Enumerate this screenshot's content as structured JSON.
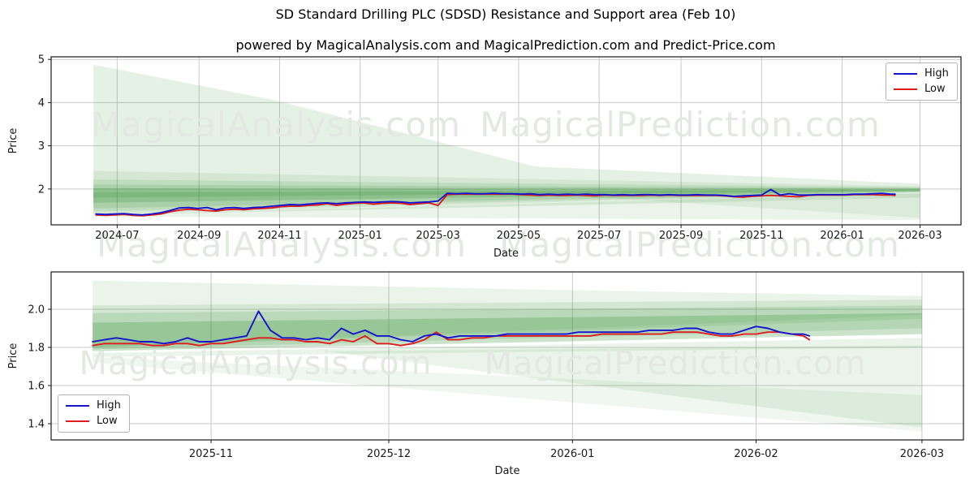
{
  "title": "SD Standard Drilling PLC (SDSD) Resistance and Support area (Feb 10)",
  "subtitle": "powered by MagicalAnalysis.com and MagicalPrediction.com and Predict-Price.com",
  "watermarks": [
    "MagicalAnalysis.com",
    "MagicalPrediction.com"
  ],
  "legend": {
    "high_label": "High",
    "low_label": "Low"
  },
  "colors": {
    "high": "#1414cc",
    "low": "#dc1e1e",
    "band": "#2f8f2f",
    "grid": "#c9c9c9",
    "spine": "#1a1a1a",
    "tick_text": "#1a1a1a",
    "watermark": "#e3e8e3"
  },
  "chart_data": [
    {
      "type": "line",
      "title": "SD Standard Drilling PLC (SDSD) Resistance and Support area (Feb 10)",
      "xlabel": "Date",
      "ylabel": "Price",
      "legend_position": "top-right",
      "grid": true,
      "x_domain": [
        "2024-05-12",
        "2026-04-01"
      ],
      "y_domain": [
        1.17,
        5.06
      ],
      "x_ticks": [
        {
          "date": "2024-07-01",
          "label": "2024-07"
        },
        {
          "date": "2024-09-01",
          "label": "2024-09"
        },
        {
          "date": "2024-11-01",
          "label": "2024-11"
        },
        {
          "date": "2025-01-01",
          "label": "2025-01"
        },
        {
          "date": "2025-03-01",
          "label": "2025-03"
        },
        {
          "date": "2025-05-01",
          "label": "2025-05"
        },
        {
          "date": "2025-07-01",
          "label": "2025-07"
        },
        {
          "date": "2025-09-01",
          "label": "2025-09"
        },
        {
          "date": "2025-11-01",
          "label": "2025-11"
        },
        {
          "date": "2026-01-01",
          "label": "2026-01"
        },
        {
          "date": "2026-03-01",
          "label": "2026-03"
        }
      ],
      "y_ticks": [
        {
          "value": 2,
          "label": "2"
        },
        {
          "value": 3,
          "label": "3"
        },
        {
          "value": 4,
          "label": "4"
        },
        {
          "value": 5,
          "label": "5"
        }
      ],
      "dates": [
        "2024-06-15",
        "2024-06-22",
        "2024-06-29",
        "2024-07-06",
        "2024-07-13",
        "2024-07-20",
        "2024-07-27",
        "2024-08-03",
        "2024-08-10",
        "2024-08-17",
        "2024-08-24",
        "2024-08-31",
        "2024-09-07",
        "2024-09-14",
        "2024-09-21",
        "2024-09-28",
        "2024-10-05",
        "2024-10-12",
        "2024-10-19",
        "2024-10-26",
        "2024-11-02",
        "2024-11-09",
        "2024-11-16",
        "2024-11-23",
        "2024-11-30",
        "2024-12-07",
        "2024-12-14",
        "2024-12-21",
        "2024-12-28",
        "2025-01-04",
        "2025-01-11",
        "2025-01-18",
        "2025-01-25",
        "2025-02-01",
        "2025-02-08",
        "2025-02-15",
        "2025-02-22",
        "2025-03-01",
        "2025-03-08",
        "2025-03-15",
        "2025-03-22",
        "2025-03-29",
        "2025-04-05",
        "2025-04-12",
        "2025-04-19",
        "2025-04-26",
        "2025-05-03",
        "2025-05-10",
        "2025-05-17",
        "2025-05-24",
        "2025-05-31",
        "2025-06-07",
        "2025-06-14",
        "2025-06-21",
        "2025-06-28",
        "2025-07-05",
        "2025-07-12",
        "2025-07-19",
        "2025-07-26",
        "2025-08-02",
        "2025-08-09",
        "2025-08-16",
        "2025-08-23",
        "2025-08-30",
        "2025-09-06",
        "2025-09-13",
        "2025-09-20",
        "2025-09-27",
        "2025-10-04",
        "2025-10-11",
        "2025-10-18",
        "2025-10-25",
        "2025-11-01",
        "2025-11-08",
        "2025-11-15",
        "2025-11-22",
        "2025-11-29",
        "2025-12-06",
        "2025-12-13",
        "2025-12-20",
        "2025-12-27",
        "2026-01-03",
        "2026-01-10",
        "2026-01-17",
        "2026-01-24",
        "2026-01-31",
        "2026-02-07",
        "2026-02-10"
      ],
      "series": [
        {
          "name": "High",
          "values": [
            1.42,
            1.41,
            1.42,
            1.43,
            1.41,
            1.4,
            1.42,
            1.45,
            1.5,
            1.56,
            1.57,
            1.55,
            1.57,
            1.52,
            1.56,
            1.57,
            1.55,
            1.57,
            1.58,
            1.6,
            1.62,
            1.64,
            1.63,
            1.65,
            1.67,
            1.68,
            1.66,
            1.68,
            1.69,
            1.7,
            1.69,
            1.7,
            1.71,
            1.7,
            1.68,
            1.69,
            1.7,
            1.72,
            1.9,
            1.89,
            1.9,
            1.89,
            1.89,
            1.9,
            1.89,
            1.89,
            1.88,
            1.89,
            1.87,
            1.88,
            1.87,
            1.88,
            1.87,
            1.88,
            1.87,
            1.87,
            1.86,
            1.87,
            1.86,
            1.87,
            1.87,
            1.86,
            1.87,
            1.86,
            1.86,
            1.87,
            1.86,
            1.86,
            1.85,
            1.83,
            1.84,
            1.85,
            1.86,
            1.99,
            1.86,
            1.89,
            1.86,
            1.86,
            1.87,
            1.87,
            1.87,
            1.87,
            1.88,
            1.88,
            1.89,
            1.9,
            1.88,
            1.88
          ]
        },
        {
          "name": "Low",
          "values": [
            1.4,
            1.39,
            1.4,
            1.41,
            1.39,
            1.38,
            1.4,
            1.42,
            1.47,
            1.51,
            1.53,
            1.52,
            1.5,
            1.49,
            1.52,
            1.53,
            1.52,
            1.54,
            1.55,
            1.56,
            1.59,
            1.6,
            1.6,
            1.62,
            1.63,
            1.66,
            1.62,
            1.65,
            1.67,
            1.68,
            1.65,
            1.67,
            1.68,
            1.67,
            1.64,
            1.66,
            1.68,
            1.62,
            1.87,
            1.88,
            1.88,
            1.88,
            1.88,
            1.88,
            1.88,
            1.88,
            1.87,
            1.86,
            1.85,
            1.86,
            1.85,
            1.85,
            1.86,
            1.85,
            1.84,
            1.86,
            1.85,
            1.85,
            1.85,
            1.85,
            1.86,
            1.85,
            1.86,
            1.85,
            1.85,
            1.85,
            1.85,
            1.85,
            1.84,
            1.82,
            1.81,
            1.83,
            1.84,
            1.85,
            1.84,
            1.83,
            1.82,
            1.85,
            1.86,
            1.86,
            1.86,
            1.86,
            1.87,
            1.87,
            1.87,
            1.86,
            1.86,
            1.85
          ]
        }
      ],
      "bands": [
        {
          "opacity": 0.12,
          "points": [
            [
              "2024-06-13",
              4.88
            ],
            [
              "2024-10-29",
              4.05
            ],
            [
              "2025-05-14",
              2.52
            ],
            [
              "2026-03-01",
              2.12
            ],
            [
              "2026-03-01",
              1.8
            ],
            [
              "2025-01-01",
              1.52
            ],
            [
              "2024-06-13",
              1.4
            ]
          ]
        },
        {
          "opacity": 0.1,
          "points": [
            [
              "2024-06-13",
              2.42
            ],
            [
              "2026-03-01",
              2.06
            ],
            [
              "2026-03-01",
              1.92
            ],
            [
              "2024-06-13",
              1.42
            ]
          ]
        },
        {
          "opacity": 0.12,
          "points": [
            [
              "2024-06-13",
              2.22
            ],
            [
              "2026-03-01",
              2.04
            ],
            [
              "2026-03-01",
              1.93
            ],
            [
              "2024-06-13",
              1.48
            ]
          ]
        },
        {
          "opacity": 0.15,
          "points": [
            [
              "2024-06-13",
              2.1
            ],
            [
              "2026-03-01",
              2.02
            ],
            [
              "2026-03-01",
              1.94
            ],
            [
              "2024-06-13",
              1.55
            ]
          ]
        },
        {
          "opacity": 0.22,
          "points": [
            [
              "2024-06-13",
              2.01
            ],
            [
              "2026-03-01",
              2.0
            ],
            [
              "2026-03-01",
              1.95
            ],
            [
              "2024-06-13",
              1.68
            ]
          ]
        },
        {
          "opacity": 0.18,
          "points": [
            [
              "2024-06-13",
              1.92
            ],
            [
              "2026-03-01",
              1.985
            ],
            [
              "2026-03-01",
              1.955
            ],
            [
              "2024-06-13",
              1.8
            ]
          ]
        },
        {
          "opacity": 0.1,
          "points": [
            [
              "2024-06-13",
              1.4
            ],
            [
              "2026-03-01",
              1.9
            ],
            [
              "2026-03-01",
              1.28
            ],
            [
              "2024-06-13",
              1.36
            ]
          ]
        },
        {
          "opacity": 0.08,
          "points": [
            [
              "2025-06-01",
              1.86
            ],
            [
              "2026-03-01",
              1.9
            ],
            [
              "2026-03-01",
              1.33
            ]
          ]
        }
      ]
    },
    {
      "type": "line",
      "title": "",
      "xlabel": "Date",
      "ylabel": "Price",
      "legend_position": "bottom-left",
      "grid": true,
      "x_domain": [
        "2025-10-05",
        "2026-03-08"
      ],
      "y_domain": [
        1.315,
        2.196
      ],
      "x_ticks": [
        {
          "date": "2025-11-01",
          "label": "2025-11"
        },
        {
          "date": "2025-12-01",
          "label": "2025-12"
        },
        {
          "date": "2026-01-01",
          "label": "2026-01"
        },
        {
          "date": "2026-02-01",
          "label": "2026-02"
        },
        {
          "date": "2026-03-01",
          "label": "2026-03"
        }
      ],
      "y_ticks": [
        {
          "value": 1.4,
          "label": "1.4"
        },
        {
          "value": 1.6,
          "label": "1.6"
        },
        {
          "value": 1.8,
          "label": "1.8"
        },
        {
          "value": 2.0,
          "label": "2.0"
        }
      ],
      "dates": [
        "2025-10-12",
        "2025-10-14",
        "2025-10-16",
        "2025-10-18",
        "2025-10-20",
        "2025-10-22",
        "2025-10-24",
        "2025-10-26",
        "2025-10-28",
        "2025-10-30",
        "2025-11-01",
        "2025-11-03",
        "2025-11-05",
        "2025-11-07",
        "2025-11-09",
        "2025-11-11",
        "2025-11-13",
        "2025-11-15",
        "2025-11-17",
        "2025-11-19",
        "2025-11-21",
        "2025-11-23",
        "2025-11-25",
        "2025-11-27",
        "2025-11-29",
        "2025-12-01",
        "2025-12-03",
        "2025-12-05",
        "2025-12-07",
        "2025-12-09",
        "2025-12-11",
        "2025-12-13",
        "2025-12-15",
        "2025-12-17",
        "2025-12-19",
        "2025-12-21",
        "2025-12-23",
        "2025-12-25",
        "2025-12-27",
        "2025-12-29",
        "2025-12-31",
        "2026-01-02",
        "2026-01-04",
        "2026-01-06",
        "2026-01-08",
        "2026-01-10",
        "2026-01-12",
        "2026-01-14",
        "2026-01-16",
        "2026-01-18",
        "2026-01-20",
        "2026-01-22",
        "2026-01-24",
        "2026-01-26",
        "2026-01-28",
        "2026-01-30",
        "2026-02-01",
        "2026-02-03",
        "2026-02-05",
        "2026-02-07",
        "2026-02-09",
        "2026-02-10"
      ],
      "series": [
        {
          "name": "High",
          "values": [
            1.83,
            1.84,
            1.85,
            1.84,
            1.83,
            1.83,
            1.82,
            1.83,
            1.85,
            1.83,
            1.83,
            1.84,
            1.85,
            1.86,
            1.99,
            1.89,
            1.85,
            1.85,
            1.84,
            1.85,
            1.84,
            1.9,
            1.87,
            1.89,
            1.86,
            1.86,
            1.84,
            1.83,
            1.86,
            1.87,
            1.85,
            1.86,
            1.86,
            1.86,
            1.86,
            1.87,
            1.87,
            1.87,
            1.87,
            1.87,
            1.87,
            1.88,
            1.88,
            1.88,
            1.88,
            1.88,
            1.88,
            1.89,
            1.89,
            1.89,
            1.9,
            1.9,
            1.88,
            1.87,
            1.87,
            1.89,
            1.91,
            1.9,
            1.88,
            1.87,
            1.87,
            1.86
          ]
        },
        {
          "name": "Low",
          "values": [
            1.81,
            1.82,
            1.82,
            1.82,
            1.82,
            1.81,
            1.81,
            1.82,
            1.82,
            1.81,
            1.82,
            1.82,
            1.83,
            1.84,
            1.85,
            1.85,
            1.84,
            1.84,
            1.83,
            1.83,
            1.82,
            1.84,
            1.83,
            1.86,
            1.82,
            1.82,
            1.81,
            1.82,
            1.84,
            1.88,
            1.84,
            1.84,
            1.85,
            1.85,
            1.86,
            1.86,
            1.86,
            1.86,
            1.86,
            1.86,
            1.86,
            1.86,
            1.86,
            1.87,
            1.87,
            1.87,
            1.87,
            1.87,
            1.87,
            1.88,
            1.88,
            1.88,
            1.87,
            1.86,
            1.86,
            1.87,
            1.87,
            1.88,
            1.88,
            1.87,
            1.86,
            1.84
          ]
        }
      ],
      "bands": [
        {
          "opacity": 0.1,
          "points": [
            [
              "2025-10-12",
              2.15
            ],
            [
              "2026-01-01",
              2.1
            ],
            [
              "2026-03-01",
              2.07
            ],
            [
              "2026-03-01",
              1.97
            ],
            [
              "2025-10-12",
              1.8
            ]
          ]
        },
        {
          "opacity": 0.12,
          "points": [
            [
              "2025-10-12",
              2.02
            ],
            [
              "2026-03-01",
              2.05
            ],
            [
              "2026-03-01",
              1.95
            ],
            [
              "2025-10-12",
              1.8
            ]
          ]
        },
        {
          "opacity": 0.15,
          "points": [
            [
              "2025-10-12",
              1.98
            ],
            [
              "2026-03-01",
              2.02
            ],
            [
              "2026-03-01",
              1.9
            ],
            [
              "2025-10-12",
              1.79
            ]
          ]
        },
        {
          "opacity": 0.25,
          "points": [
            [
              "2025-10-12",
              1.93
            ],
            [
              "2026-03-01",
              1.98
            ],
            [
              "2026-03-01",
              1.87
            ],
            [
              "2025-10-12",
              1.78
            ]
          ]
        },
        {
          "opacity": 0.1,
          "points": [
            [
              "2025-10-12",
              1.77
            ],
            [
              "2026-03-01",
              1.85
            ],
            [
              "2026-03-01",
              1.8
            ],
            [
              "2025-10-12",
              1.75
            ]
          ]
        },
        {
          "opacity": 0.1,
          "points": [
            [
              "2025-11-20",
              1.78
            ],
            [
              "2026-03-01",
              1.81
            ],
            [
              "2026-03-01",
              1.38
            ]
          ]
        },
        {
          "opacity": 0.07,
          "points": [
            [
              "2025-10-12",
              1.75
            ],
            [
              "2026-03-01",
              1.55
            ],
            [
              "2026-03-01",
              1.36
            ],
            [
              "2025-10-12",
              1.72
            ]
          ]
        }
      ]
    }
  ]
}
